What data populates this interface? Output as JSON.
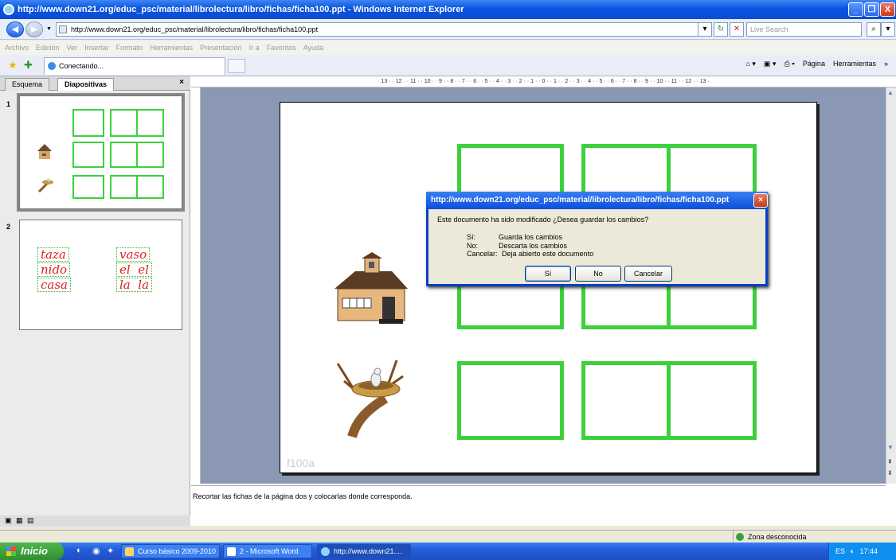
{
  "window": {
    "title": "http://www.down21.org/educ_psc/material/librolectura/libro/fichas/ficha100.ppt - Windows Internet Explorer",
    "minimize": "_",
    "maximize": "❐",
    "close": "X"
  },
  "address": {
    "url": "http://www.down21.org/educ_psc/material/librolectura/libro/fichas/ficha100.ppt",
    "search_placeholder": "Live Search"
  },
  "menu": [
    "Archivo",
    "Edición",
    "Ver",
    "Insertar",
    "Formato",
    "Herramientas",
    "Presentación",
    "Ir a",
    "Favoritos",
    "Ayuda"
  ],
  "tab": {
    "label": "Conectando..."
  },
  "toolbar": {
    "page": "Página",
    "tools": "Herramientas"
  },
  "ppt": {
    "tab_outline": "Esquema",
    "tab_slides": "Diapositivas",
    "close_pane": "×",
    "slide1_num": "1",
    "slide2_num": "2",
    "slide2_words_left": [
      "taza",
      "nido",
      "casa"
    ],
    "slide2_words_right": [
      "vaso",
      "el  el",
      "la  la"
    ],
    "ruler_top": "· 13 · · 12 · · 11 · · 10 · · 9 · · 8 · · 7 · · 6 · · 5 · · 4 · · 3 · · 2 · · 1 · · 0 · · 1 · · 2 · · 3 · · 4 · · 5 · · 6 · · 7 · · 8 · · 9 · · 10 · · 11 · · 12 · · 13 ·",
    "slide_label": "f100a",
    "notes": "Recortar las fichas de la página dos y colocarlas donde corresponda."
  },
  "status": {
    "zone": "Zona desconocida"
  },
  "dialog": {
    "title": "http://www.down21.org/educ_psc/material/librolectura/libro/fichas/ficha100.ppt",
    "message": "Este documento ha sido modificado ¿Desea guardar los cambios?",
    "options": [
      {
        "key": "Sí:",
        "desc": "Guarda los cambios"
      },
      {
        "key": "No:",
        "desc": "Descarta los cambios"
      },
      {
        "key": "Cancelar:",
        "desc": "Deja abierto este documento"
      }
    ],
    "yes": "Sí",
    "no": "No",
    "cancel": "Cancelar"
  },
  "taskbar": {
    "start": "Inicio",
    "tasks": [
      "Curso básico 2009-2010",
      "2 - Microsoft Word",
      "http://www.down21...."
    ],
    "lang": "ES",
    "clock": "17:44"
  }
}
